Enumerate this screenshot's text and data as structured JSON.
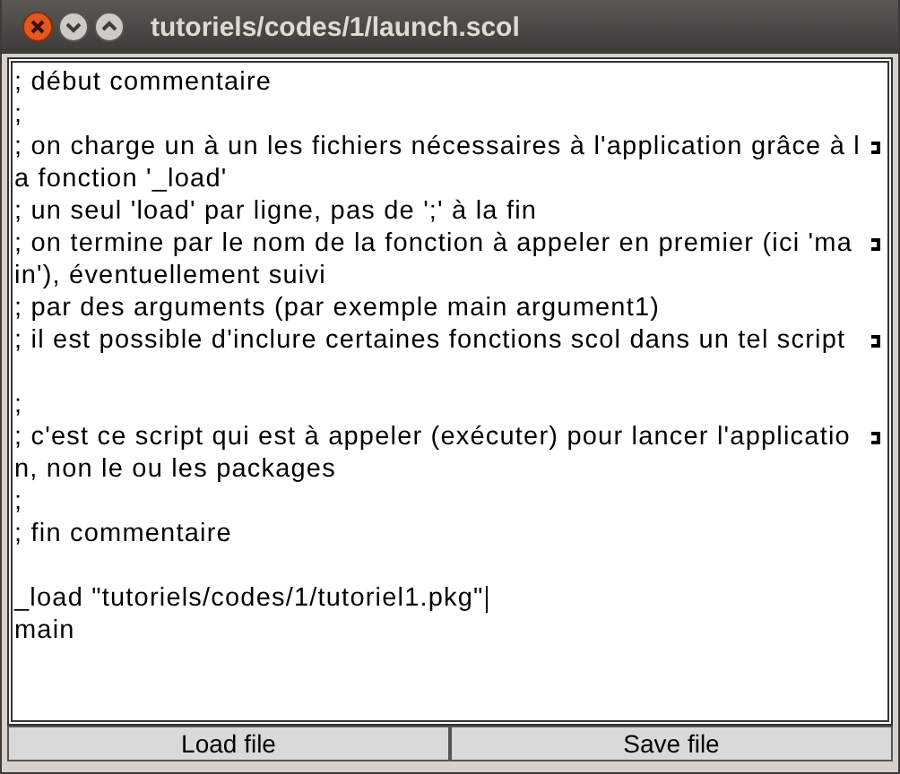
{
  "window": {
    "title": "tutoriels/codes/1/launch.scol"
  },
  "editor": {
    "lines": [
      {
        "kind": "text",
        "text": "; début commentaire"
      },
      {
        "kind": "text",
        "text": ";"
      },
      {
        "kind": "text",
        "text": "; on charge un à un les fichiers nécessaires à l'application grâce à l",
        "wrap": true
      },
      {
        "kind": "text",
        "text": "a fonction '_load'"
      },
      {
        "kind": "text",
        "text": "; un seul 'load' par ligne, pas de ';' à la fin"
      },
      {
        "kind": "text",
        "text": "; on termine par le nom de la fonction à appeler en premier (ici 'ma",
        "wrap": true
      },
      {
        "kind": "text",
        "text": "in'), éventuellement suivi"
      },
      {
        "kind": "text",
        "text": "; par des arguments (par exemple main argument1)"
      },
      {
        "kind": "text",
        "text": "; il est possible d'inclure certaines fonctions scol dans un tel script",
        "wrap": true
      },
      {
        "kind": "blank"
      },
      {
        "kind": "text",
        "text": ";"
      },
      {
        "kind": "text",
        "text": "; c'est ce script qui est à appeler (exécuter) pour lancer l'applicatio",
        "wrap": true
      },
      {
        "kind": "text",
        "text": "n, non le ou les packages"
      },
      {
        "kind": "text",
        "text": ";"
      },
      {
        "kind": "text",
        "text": "; fin commentaire"
      },
      {
        "kind": "blank"
      },
      {
        "kind": "text",
        "text": "_load \"tutoriels/codes/1/tutoriel1.pkg\"",
        "cursor": true
      },
      {
        "kind": "text",
        "text": "main"
      }
    ]
  },
  "buttons": [
    "Load file",
    "Save file"
  ]
}
